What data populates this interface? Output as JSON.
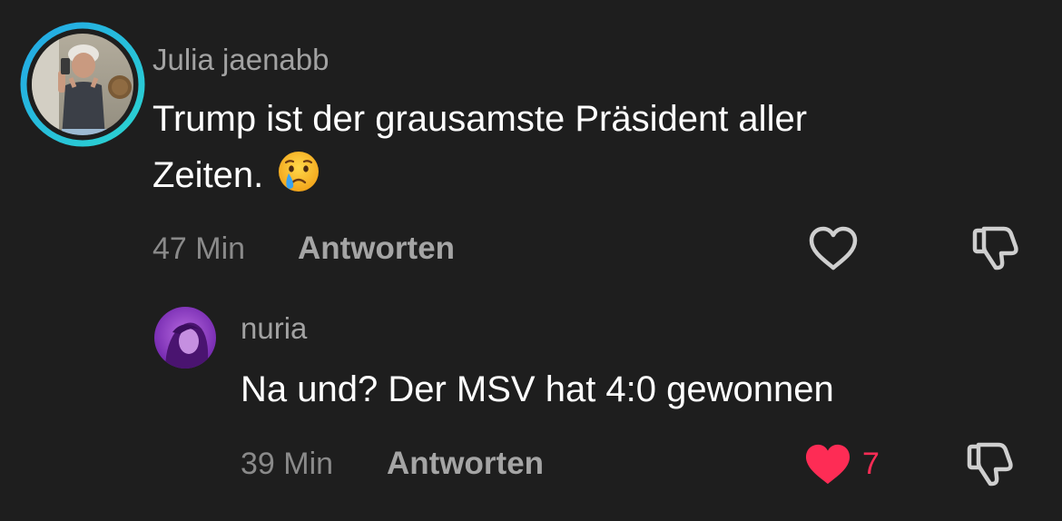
{
  "comments": [
    {
      "author": "Julia jaenabb",
      "text_line1": "Trump ist der grausamste Präsident aller",
      "text_line2": "Zeiten.",
      "emoji": "crying-face-emoji",
      "time": "47 Min",
      "reply_label": "Antworten",
      "liked": false,
      "avatar_ring_colors": [
        "#2bd4d0",
        "#23a7e6"
      ]
    }
  ],
  "reply": {
    "author": "nuria",
    "text": "Na und? Der MSV hat 4:0 gewonnen",
    "time": "39 Min",
    "reply_label": "Antworten",
    "liked": true,
    "like_count": "7",
    "like_color": "#fe2c55"
  },
  "colors": {
    "background": "#1e1e1e",
    "author": "#a2a2a2",
    "text": "#ffffff",
    "meta": "#8a8a8a"
  },
  "icons": [
    "heart-outline-icon",
    "thumbs-down-icon",
    "heart-filled-icon"
  ]
}
